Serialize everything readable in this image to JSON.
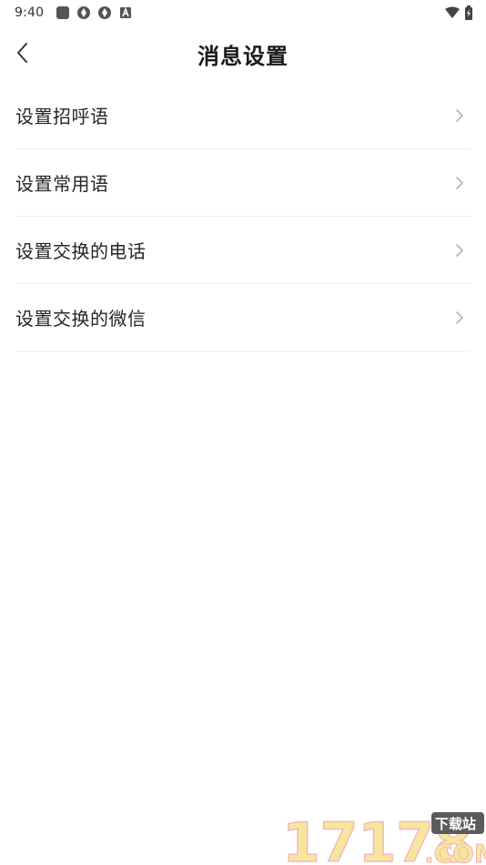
{
  "status_bar": {
    "time": "9:40",
    "left_icons": [
      "square-app-icon",
      "aperture-icon",
      "aperture-icon",
      "font-a-icon"
    ],
    "right_icons": [
      "wifi-icon",
      "battery-charging-icon"
    ]
  },
  "header": {
    "back_icon": "chevron-left-icon",
    "title": "消息设置"
  },
  "settings": {
    "items": [
      {
        "label": "设置招呼语",
        "icon": "chevron-right-icon"
      },
      {
        "label": "设置常用语",
        "icon": "chevron-right-icon"
      },
      {
        "label": "设置交换的电话",
        "icon": "chevron-right-icon"
      },
      {
        "label": "设置交换的微信",
        "icon": "chevron-right-icon"
      }
    ]
  },
  "watermark": {
    "number": "17178",
    "badge": "下载站",
    "domain": ".COM"
  },
  "colors": {
    "background": "#ffffff",
    "title": "#1a1a1a",
    "label": "#262626",
    "divider": "#ececec",
    "chevron": "#b5b5b5",
    "watermark_yellow": "#f6e79a",
    "watermark_pink": "#f3b8c4",
    "watermark_badge": "#5b5b5b"
  }
}
